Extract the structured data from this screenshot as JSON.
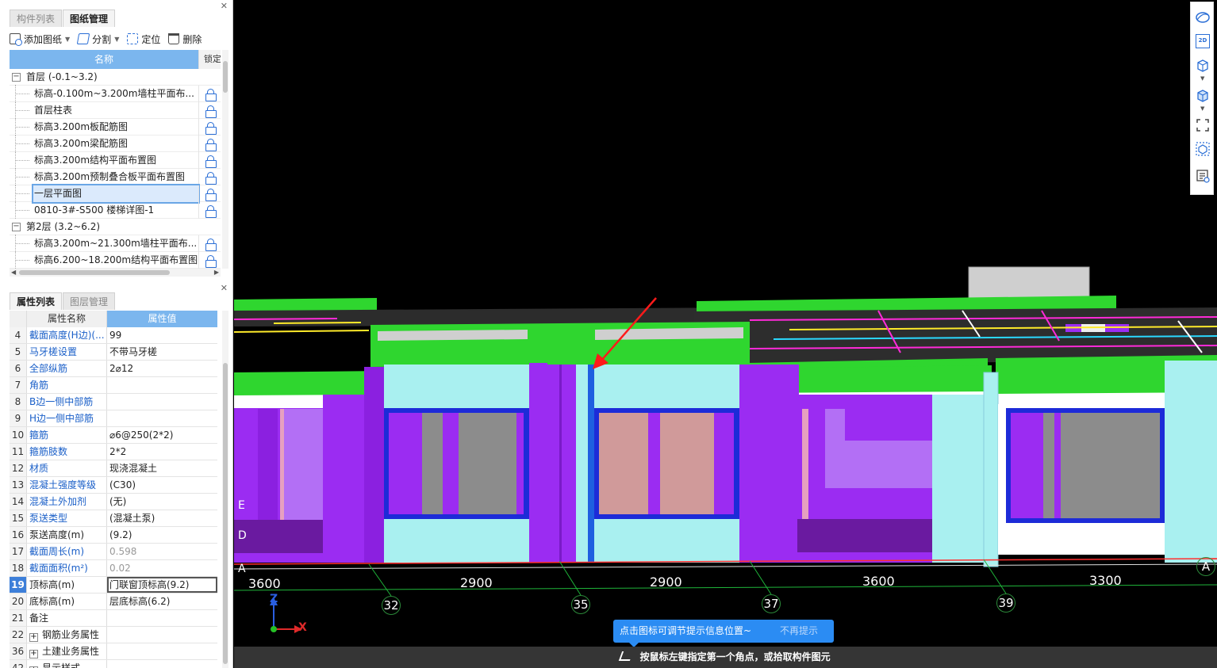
{
  "drawing_panel": {
    "tabs": [
      "构件列表",
      "图纸管理"
    ],
    "toolbar": {
      "add": "添加图纸",
      "split": "分割",
      "locate": "定位",
      "delete": "删除"
    },
    "header": {
      "name": "名称",
      "lock": "锁定"
    },
    "tree": [
      {
        "type": "group",
        "label": "首层 (-0.1~3.2)",
        "expander": "−"
      },
      {
        "type": "child",
        "label": "标高-0.100m~3.200m墙柱平面布..."
      },
      {
        "type": "child",
        "label": "首层柱表"
      },
      {
        "type": "child",
        "label": "标高3.200m板配筋图"
      },
      {
        "type": "child",
        "label": "标高3.200m梁配筋图"
      },
      {
        "type": "child",
        "label": "标高3.200m结构平面布置图"
      },
      {
        "type": "child",
        "label": "标高3.200m预制叠合板平面布置图"
      },
      {
        "type": "child",
        "label": "一层平面图",
        "selected": true
      },
      {
        "type": "child",
        "label": "0810-3#-S500 楼梯详图-1"
      },
      {
        "type": "group",
        "label": "第2层 (3.2~6.2)",
        "expander": "−"
      },
      {
        "type": "child",
        "label": "标高3.200m~21.300m墙柱平面布..."
      },
      {
        "type": "child",
        "label": "标高6.200~18.200m结构平面布置图"
      }
    ]
  },
  "property_panel": {
    "tabs": [
      "属性列表",
      "图层管理"
    ],
    "header": {
      "name": "属性名称",
      "value": "属性值"
    },
    "rows": [
      {
        "idx": "4",
        "name": "截面高度(H边)(...",
        "value": "99",
        "blue": true
      },
      {
        "idx": "5",
        "name": "马牙槎设置",
        "value": "不带马牙槎",
        "blue": true
      },
      {
        "idx": "6",
        "name": "全部纵筋",
        "value": "2⌀12",
        "blue": true
      },
      {
        "idx": "7",
        "name": "角筋",
        "value": "",
        "blue": true
      },
      {
        "idx": "8",
        "name": "B边一侧中部筋",
        "value": "",
        "blue": true
      },
      {
        "idx": "9",
        "name": "H边一侧中部筋",
        "value": "",
        "blue": true
      },
      {
        "idx": "10",
        "name": "箍筋",
        "value": "⌀6@250(2*2)",
        "blue": true
      },
      {
        "idx": "11",
        "name": "箍筋肢数",
        "value": "2*2",
        "blue": true
      },
      {
        "idx": "12",
        "name": "材质",
        "value": "现浇混凝土",
        "blue": true
      },
      {
        "idx": "13",
        "name": "混凝土强度等级",
        "value": "(C30)",
        "blue": true
      },
      {
        "idx": "14",
        "name": "混凝土外加剂",
        "value": "(无)",
        "blue": true
      },
      {
        "idx": "15",
        "name": "泵送类型",
        "value": "(混凝土泵)",
        "blue": true
      },
      {
        "idx": "16",
        "name": "泵送高度(m)",
        "value": "(9.2)",
        "blue": false
      },
      {
        "idx": "17",
        "name": "截面周长(m)",
        "value": "0.598",
        "blue": true,
        "grey": true
      },
      {
        "idx": "18",
        "name": "截面面积(m²)",
        "value": "0.02",
        "blue": true,
        "grey": true
      },
      {
        "idx": "19",
        "name": "顶标高(m)",
        "value": "门联窗顶标高(9.2)",
        "blue": false,
        "selected": true
      },
      {
        "idx": "20",
        "name": "底标高(m)",
        "value": "层底标高(6.2)",
        "blue": false
      },
      {
        "idx": "21",
        "name": "备注",
        "value": "",
        "blue": false
      },
      {
        "idx": "22",
        "name": "钢筋业务属性",
        "value": "",
        "blue": false,
        "expander": "+"
      },
      {
        "idx": "36",
        "name": "土建业务属性",
        "value": "",
        "blue": false,
        "expander": "+"
      },
      {
        "idx": "42",
        "name": "显示样式",
        "value": "",
        "blue": false,
        "expander": "+"
      }
    ]
  },
  "viewport": {
    "dimensions": [
      "3600",
      "2900",
      "2900",
      "3600",
      "3300"
    ],
    "axes": [
      "32",
      "35",
      "37",
      "39"
    ],
    "side_letters": [
      "E",
      "D",
      "A"
    ],
    "right_axis_label": "A",
    "coord_axes": {
      "z": "Z",
      "x": "X"
    },
    "hint": {
      "text": "点击图标可调节提示信息位置~",
      "dismiss": "不再提示"
    },
    "status": "按鼠标左键指定第一个角点，或拾取构件图元"
  },
  "right_toolbar": {
    "icons": [
      "orbit-icon",
      "2d-view-icon",
      "3d-box-icon",
      "3d-box-solid-icon",
      "fullscreen-icon",
      "cube-view-icon",
      "properties-icon"
    ],
    "label_2d": "2D"
  },
  "colors": {
    "accent": "#7bb6ee",
    "selection": "#3d7fd9",
    "roof_green": "#2fd62f",
    "wall_purple": "#9b2cf2",
    "glass_cyan": "#a9f0f0",
    "hint_blue": "#2b8cf3"
  }
}
